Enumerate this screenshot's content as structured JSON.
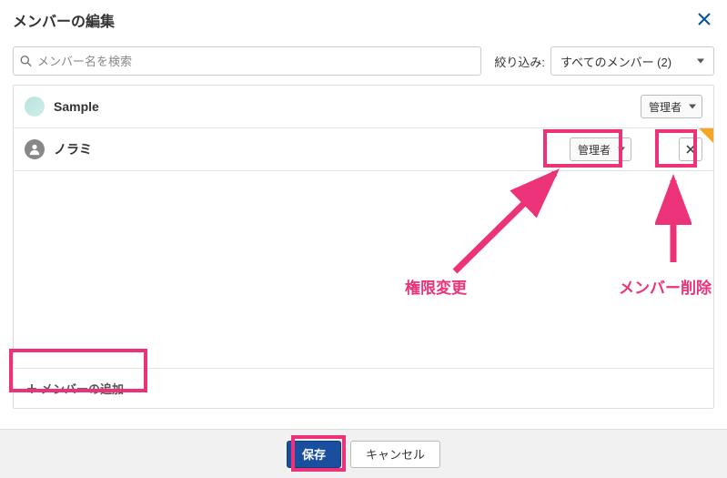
{
  "dialog": {
    "title": "メンバーの編集"
  },
  "search": {
    "placeholder": "メンバー名を検索"
  },
  "filter": {
    "label": "絞り込み:",
    "value": "すべてのメンバー (2)"
  },
  "members": [
    {
      "name": "Sample",
      "role": "管理者",
      "removable": false,
      "avatar": "sample"
    },
    {
      "name": "ノラミ",
      "role": "管理者",
      "removable": true,
      "avatar": "generic"
    }
  ],
  "add_member_label": "メンバーの追加",
  "footer": {
    "save_label": "保存",
    "cancel_label": "キャンセル"
  },
  "annotations": {
    "role_label": "権限変更",
    "remove_label": "メンバー削除"
  }
}
